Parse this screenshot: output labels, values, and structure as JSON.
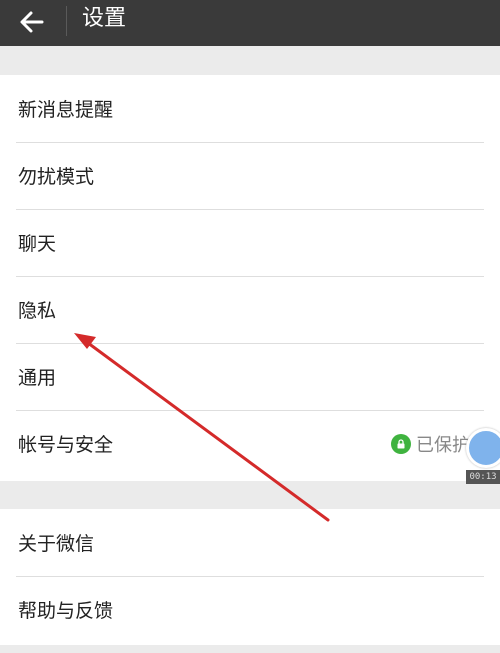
{
  "header": {
    "title": "设置",
    "back_icon": "back-arrow-icon"
  },
  "group1": [
    {
      "label": "新消息提醒"
    },
    {
      "label": "勿扰模式"
    },
    {
      "label": "聊天"
    },
    {
      "label": "隐私"
    },
    {
      "label": "通用"
    },
    {
      "label": "帐号与安全",
      "status": "已保护",
      "status_icon": "lock-icon"
    }
  ],
  "group2": [
    {
      "label": "关于微信"
    },
    {
      "label": "帮助与反馈"
    }
  ],
  "overlay": {
    "timer": "00:13",
    "arrow_color": "#d42a2a"
  },
  "colors": {
    "titlebar": "#3a3a3a",
    "page_bg": "#ebebeb",
    "protected_green": "#3fb33f"
  }
}
